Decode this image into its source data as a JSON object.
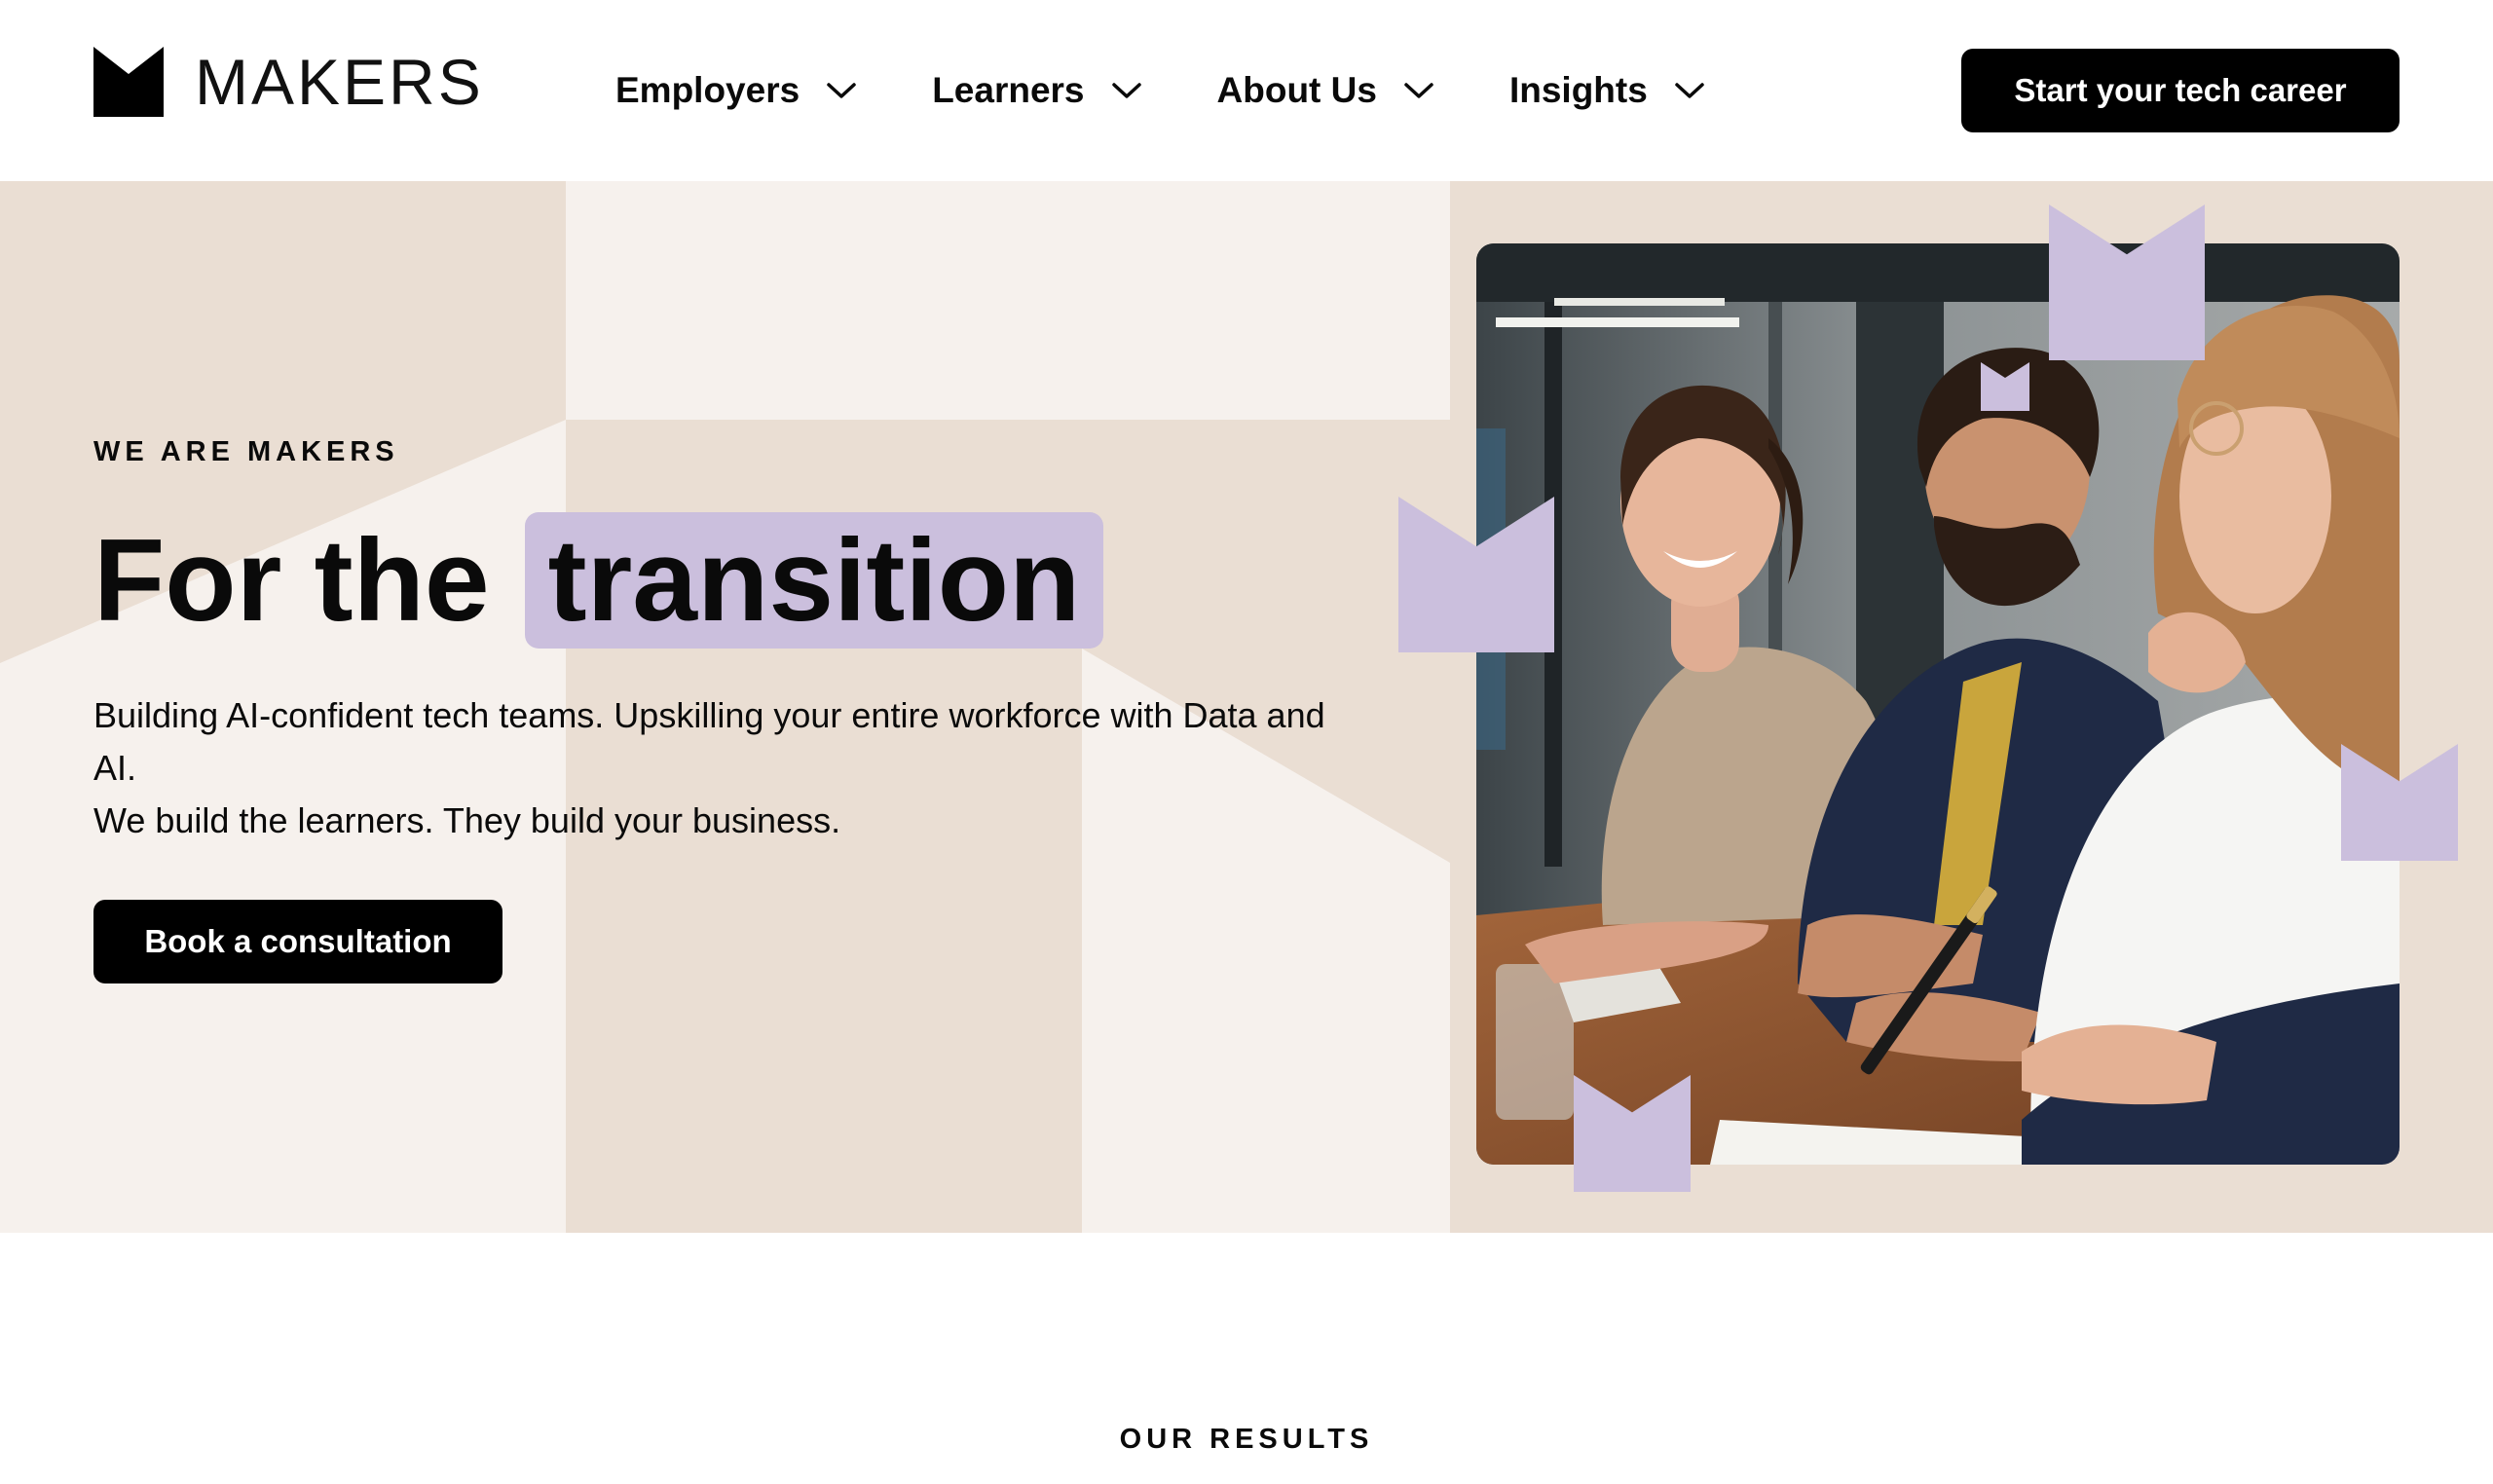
{
  "brand": {
    "name": "MAKERS",
    "logo_icon": "makers-crown-icon"
  },
  "nav": {
    "items": [
      {
        "label": "Employers",
        "icon": "chevron-down-icon"
      },
      {
        "label": "Learners",
        "icon": "chevron-down-icon"
      },
      {
        "label": "About Us",
        "icon": "chevron-down-icon"
      },
      {
        "label": "Insights",
        "icon": "chevron-down-icon"
      }
    ],
    "cta_label": "Start your tech career"
  },
  "hero": {
    "eyebrow": "WE ARE MAKERS",
    "headline_prefix": "For the",
    "headline_highlight": "transition",
    "subtitle_line1": "Building AI-confident tech teams. Upskilling your entire workforce with Data and AI.",
    "subtitle_line2": "We build the learners. They build your business.",
    "cta_label": "Book a consultation"
  },
  "results": {
    "label": "OUR RESULTS"
  },
  "colors": {
    "beige_light": "#f6f1ed",
    "beige_dark": "#eaded3",
    "lavender": "#cbbfdd",
    "black": "#000000",
    "white": "#ffffff"
  }
}
